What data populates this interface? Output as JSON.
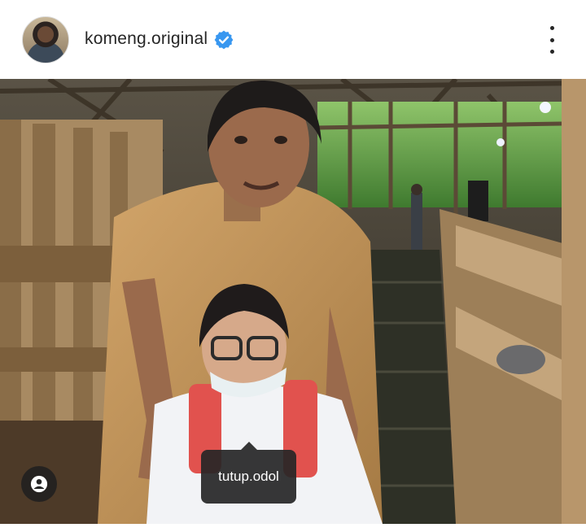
{
  "post": {
    "username": "komeng.original",
    "verified": true,
    "avatar_icon": "profile-avatar",
    "more_icon": "more-vertical-icon"
  },
  "photo": {
    "tag_icon": "user-tag-icon",
    "tags": [
      {
        "label": "tutup.odol"
      }
    ]
  },
  "colors": {
    "verified_blue": "#3897f0",
    "text": "#262626",
    "tag_bg": "#262626"
  }
}
